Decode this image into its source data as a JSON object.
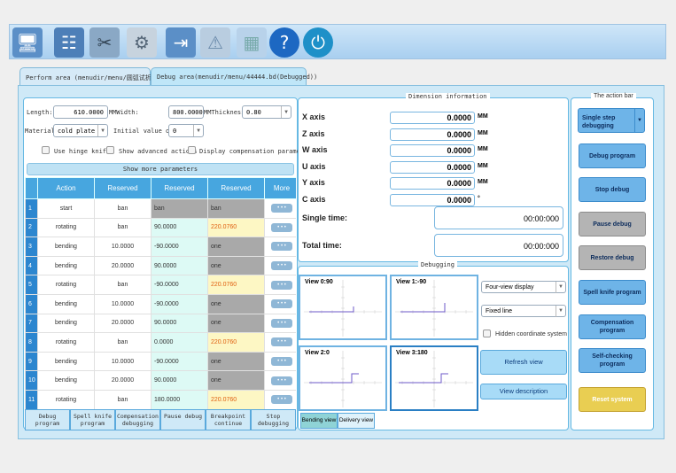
{
  "toolbar": {
    "icons": [
      "computer-icon",
      "settings-sliders-icon",
      "tools-icon",
      "gear-icon",
      "import-icon",
      "warning-icon",
      "apps-icon",
      "help-icon",
      "power-icon"
    ]
  },
  "tabs": [
    {
      "label": "Perform area (menudir/menu/圆弧试折.bd)"
    },
    {
      "label": "Debug area(menudir/menu/44444.bd(Debugged))"
    }
  ],
  "params": {
    "length_label": "Length:",
    "length": "610.0000",
    "width_label": "MMWidth:",
    "width": "800.0000",
    "thickness_label": "MMThickness:",
    "thickness": "0.80",
    "material_label": "Material:",
    "material": "cold plate",
    "initial_label": "Initial value of",
    "initial": "0",
    "hinge_knife": "Use hinge knife",
    "advanced": "Show advanced actions",
    "compensation": "Display compensation parameters",
    "show_more": "Show more parameters"
  },
  "table": {
    "headers": [
      "Action",
      "Reserved",
      "Reserved",
      "Reserved",
      "More"
    ],
    "rows": [
      [
        "1",
        "start",
        "ban",
        "ban",
        "ban"
      ],
      [
        "2",
        "rotating",
        "ban",
        "90.0000",
        "220.0760"
      ],
      [
        "3",
        "bending",
        "10.0000",
        "-90.0000",
        "one"
      ],
      [
        "4",
        "bending",
        "20.0000",
        "90.0000",
        "one"
      ],
      [
        "5",
        "rotating",
        "ban",
        "-90.0000",
        "220.0760"
      ],
      [
        "6",
        "bending",
        "10.0000",
        "-90.0000",
        "one"
      ],
      [
        "7",
        "bending",
        "20.0000",
        "90.0000",
        "one"
      ],
      [
        "8",
        "rotating",
        "ban",
        "0.0000",
        "220.0760"
      ],
      [
        "9",
        "bending",
        "10.0000",
        "-90.0000",
        "one"
      ],
      [
        "10",
        "bending",
        "20.0000",
        "90.0000",
        "one"
      ],
      [
        "11",
        "rotating",
        "ban",
        "180.0000",
        "220.0760"
      ]
    ]
  },
  "bottom_buttons": [
    "Debug program",
    "Spell knife program",
    "Compensation debugging",
    "Pause debug",
    "Breakpoint continue",
    "Stop debugging"
  ],
  "dimension": {
    "title": "Dimension information",
    "axes": [
      {
        "label": "X axis",
        "value": "0.0000",
        "unit": "MM"
      },
      {
        "label": "Z axis",
        "value": "0.0000",
        "unit": "MM"
      },
      {
        "label": "W axis",
        "value": "0.0000",
        "unit": "MM"
      },
      {
        "label": "U axis",
        "value": "0.0000",
        "unit": "MM"
      },
      {
        "label": "Y axis",
        "value": "0.0000",
        "unit": "MM"
      },
      {
        "label": "C axis",
        "value": "0.0000",
        "unit": "°"
      }
    ],
    "single_time_label": "Single time:",
    "single_time": "00:00:000",
    "total_time_label": "Total time:",
    "total_time": "00:00:000"
  },
  "debugging": {
    "title": "Debugging",
    "views": [
      "View 0:90",
      "View 1:-90",
      "View 2:0",
      "View 3:180"
    ],
    "display_mode": "Four-view display",
    "line_mode": "Fixed line",
    "hidden_coord": "Hidden coordinate system",
    "refresh": "Refresh view",
    "description": "View description",
    "tab_bending": "Bending view",
    "tab_delivery": "Delivery view"
  },
  "action_bar": {
    "title": "The action bar",
    "single_step": "Single step debugging",
    "buttons": [
      "Debug program",
      "Stop debug",
      "Pause debug",
      "Restore debug",
      "Spell knife program",
      "Compensation program",
      "Self-checking program",
      "Reset system"
    ]
  }
}
